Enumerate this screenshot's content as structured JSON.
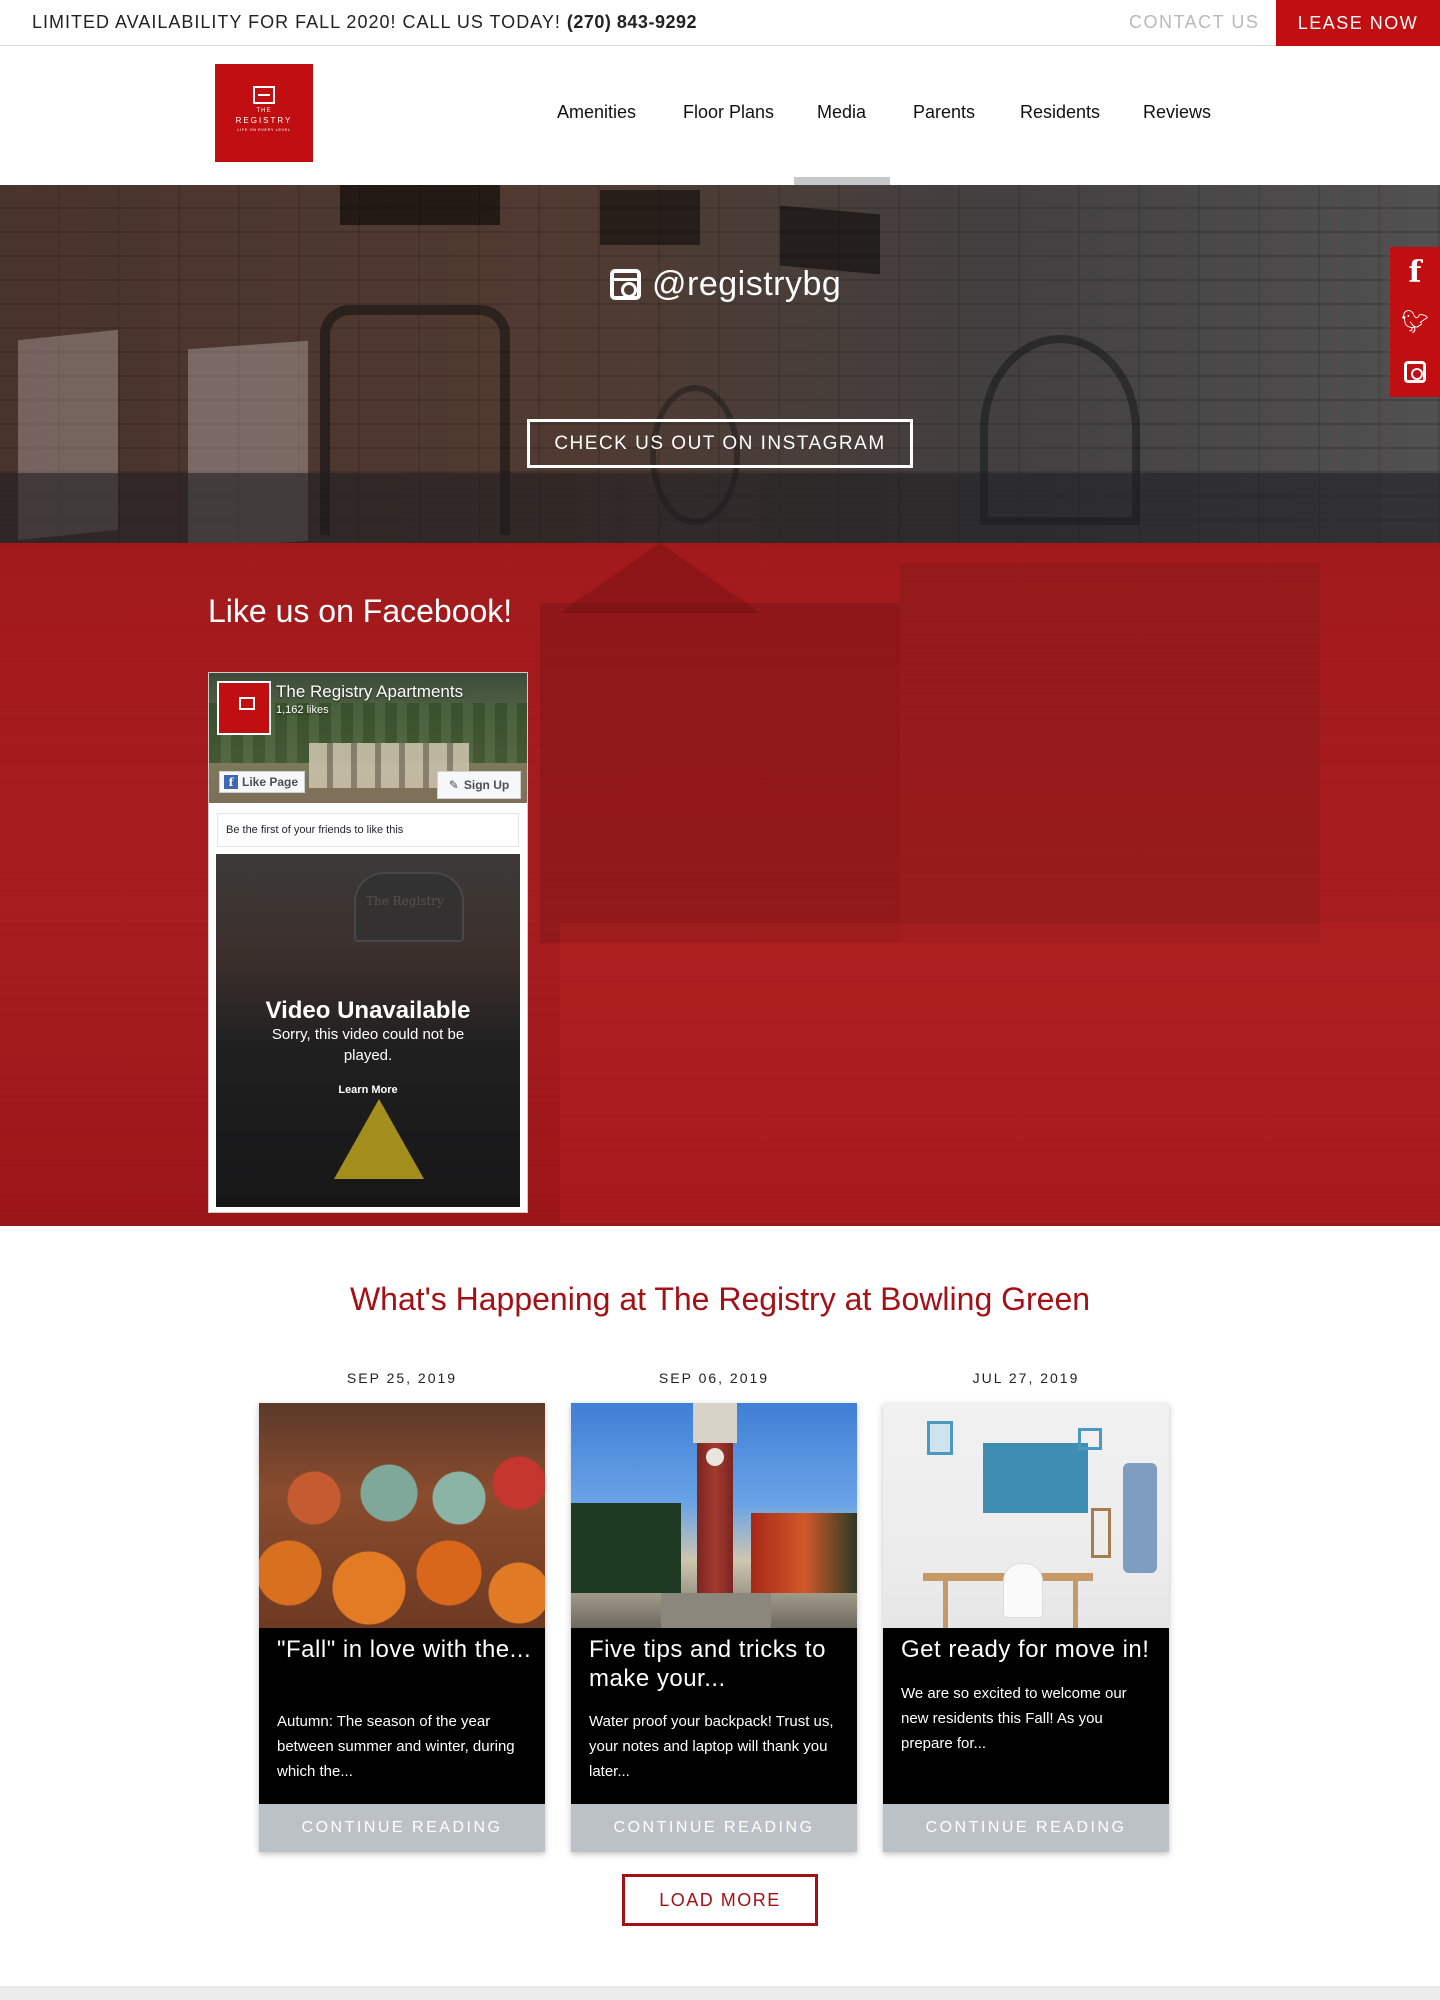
{
  "topbar": {
    "promo": "LIMITED AVAILABILITY FOR FALL 2020! CALL US TODAY!",
    "phone": "(270) 843-9292",
    "contact_label": "CONTACT US",
    "lease_label": "LEASE NOW"
  },
  "logo": {
    "the": "THE",
    "name": "REGISTRY",
    "tagline": "LIFE ON EVERY LEVEL"
  },
  "nav": {
    "items": [
      "Amenities",
      "Floor Plans",
      "Media",
      "Parents",
      "Residents",
      "Reviews"
    ],
    "active": "Media"
  },
  "instagram": {
    "handle": "@registrybg",
    "button_label": "CHECK US OUT ON INSTAGRAM",
    "icon": "instagram-icon"
  },
  "social": {
    "icons": [
      "facebook-icon",
      "twitter-icon",
      "instagram-icon"
    ]
  },
  "facebook": {
    "heading": "Like us on Facebook!",
    "page_name": "The Registry Apartments",
    "likes": "1,162 likes",
    "like_button": "Like Page",
    "signup_button": "Sign Up",
    "friends_text": "Be the first of your friends to like this",
    "video_title": "Video Unavailable",
    "video_message": "Sorry, this video could not be played.",
    "video_link": "Learn More",
    "sign_text": "The Registry"
  },
  "happening": {
    "title": "What's Happening at The Registry at Bowling Green",
    "posts": [
      {
        "date": "SEP 25, 2019",
        "title": "\"Fall\" in love with the...",
        "excerpt": "Autumn: The season of the year between summer and winter, during which the...",
        "cta": "CONTINUE READING"
      },
      {
        "date": "SEP 06, 2019",
        "title": "Five tips and tricks to make your...",
        "excerpt": "Water proof your backpack! Trust us, your notes and laptop will thank you later...",
        "cta": "CONTINUE READING"
      },
      {
        "date": "JUL 27, 2019",
        "title": "Get ready for move in!",
        "excerpt": "We are so excited to welcome our new residents this Fall! As you prepare for...",
        "cta": "CONTINUE READING"
      }
    ],
    "load_more": "LOAD MORE"
  },
  "colors": {
    "brand_red": "#c10f11",
    "heading_red": "#a31116",
    "cta_gray": "#bcc1c6"
  }
}
